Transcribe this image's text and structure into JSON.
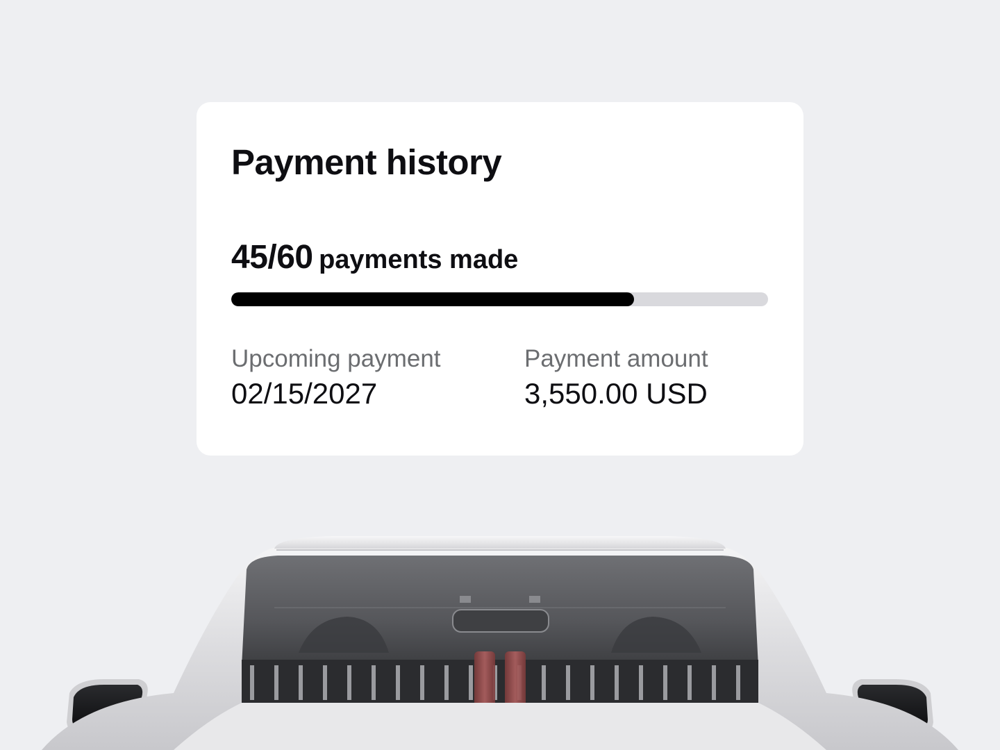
{
  "card": {
    "title": "Payment history",
    "progress": {
      "count_label": "45/60",
      "suffix": "payments made",
      "made": 45,
      "total": 60,
      "fraction": 0.75
    },
    "upcoming": {
      "label": "Upcoming payment",
      "value": "02/15/2027"
    },
    "amount": {
      "label": "Payment amount",
      "value": "3,550.00 USD"
    }
  },
  "colors": {
    "background": "#eeeff2",
    "card": "#ffffff",
    "text_primary": "#0e0e12",
    "text_secondary": "#6b6d70",
    "progress_fill": "#000000",
    "progress_track": "#d9d9dd"
  },
  "illustration": {
    "subject": "white-sports-car-rear-view"
  }
}
